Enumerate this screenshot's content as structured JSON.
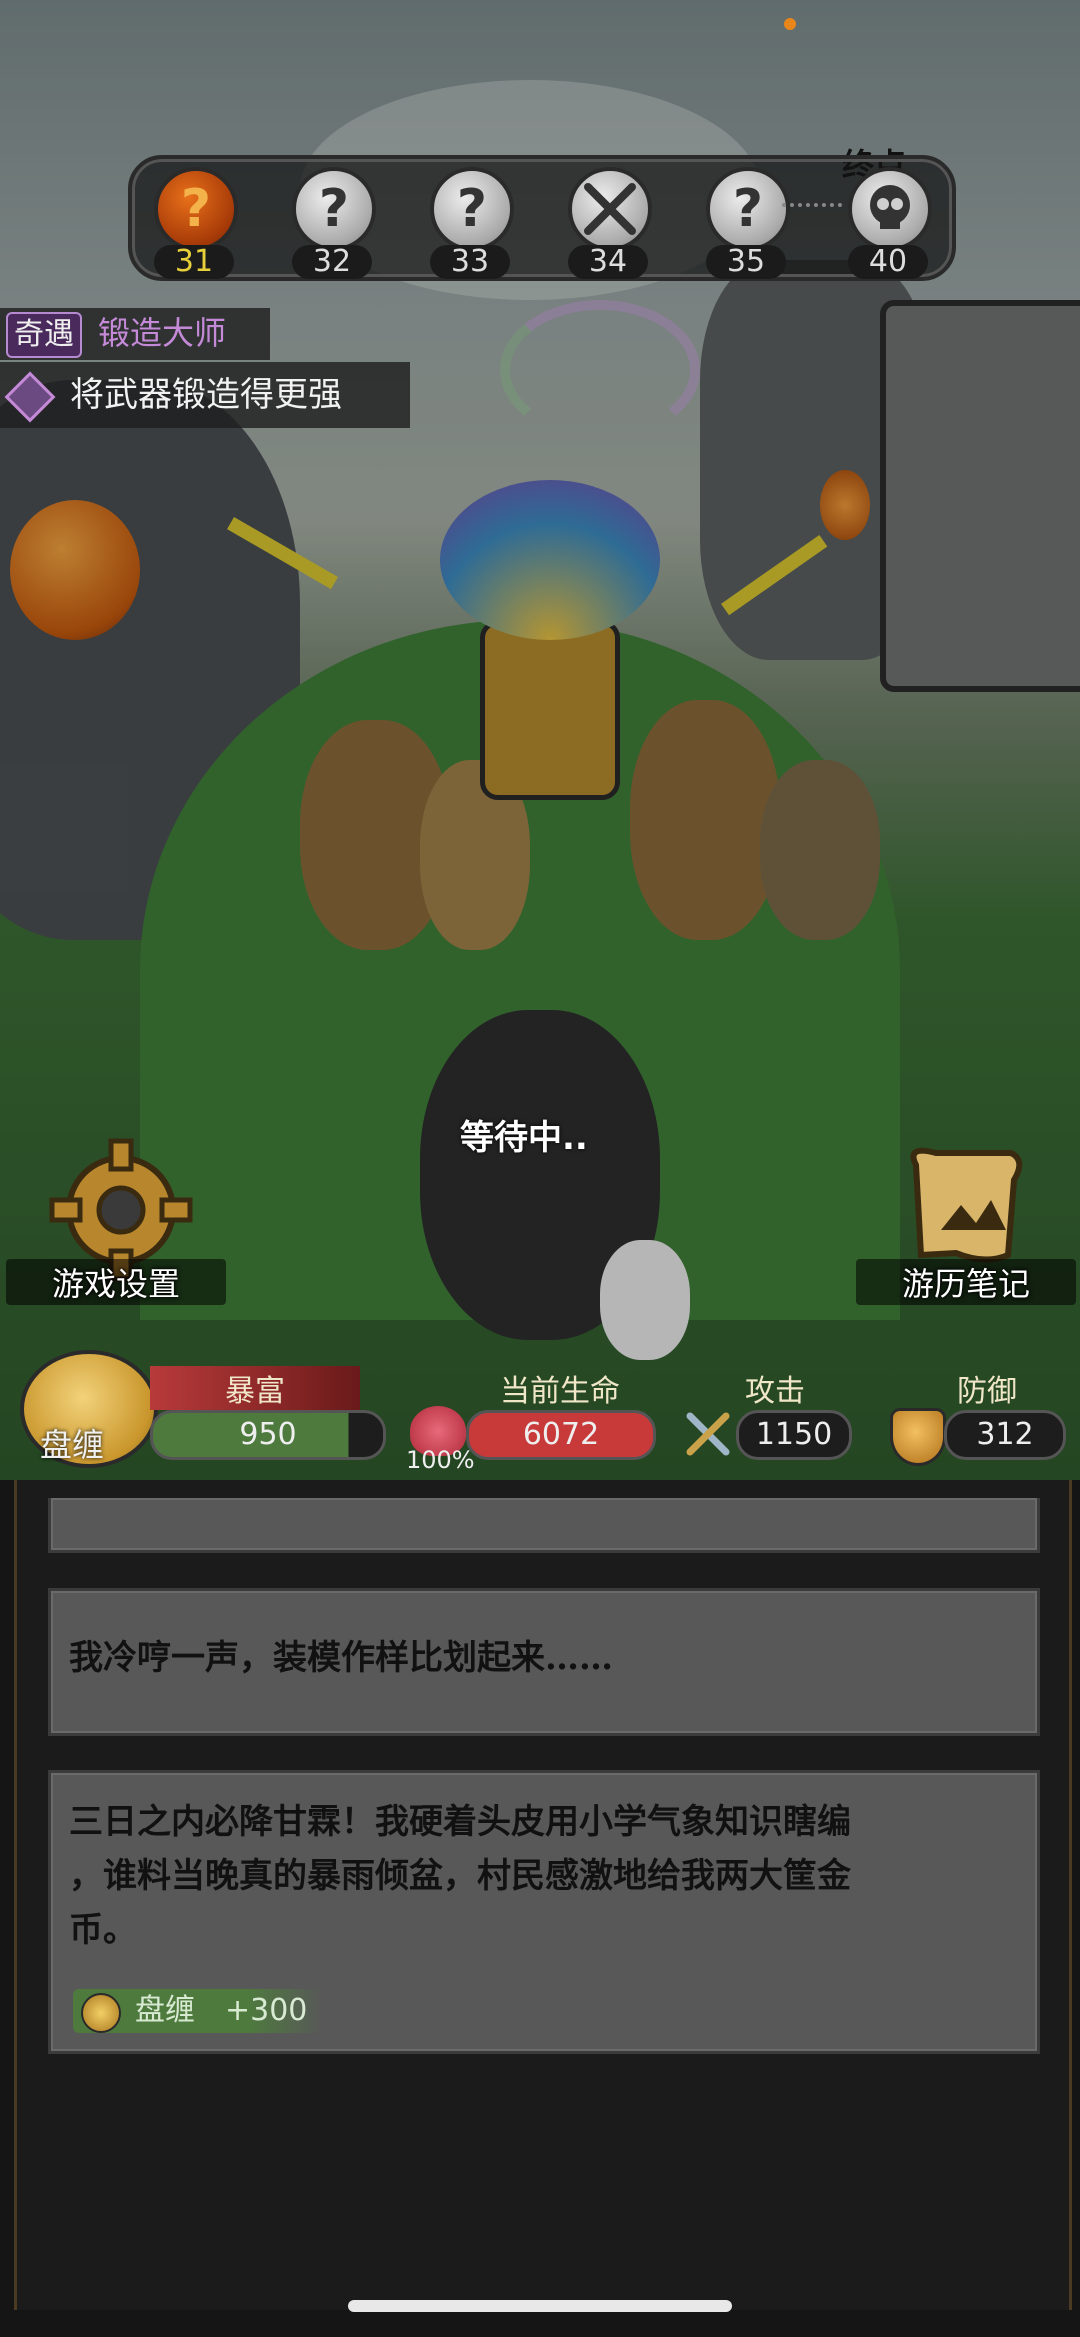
{
  "stages": [
    {
      "label": "?",
      "number": "31",
      "current": true
    },
    {
      "label": "?",
      "number": "32",
      "current": false
    },
    {
      "label": "?",
      "number": "33",
      "current": false
    },
    {
      "label": "sword",
      "number": "34",
      "current": false
    },
    {
      "label": "?",
      "number": "35",
      "current": false
    },
    {
      "label": "skull",
      "number": "40",
      "current": false
    }
  ],
  "end_label": "终点",
  "event": {
    "tag": "奇遇",
    "title": "锻造大师",
    "goal": "将武器锻造得更强"
  },
  "hud": {
    "settings_label": "游戏设置",
    "journal_label": "游历笔记",
    "waiting_text": "等待中.."
  },
  "stats": {
    "buff_title": "暴富",
    "coin_name": "盘缠",
    "coins": "950",
    "hp_title": "当前生命",
    "hp_percent": "100%",
    "hp": "6072",
    "atk_title": "攻击",
    "atk": "1150",
    "def_title": "防御",
    "def": "312"
  },
  "log": {
    "entry1": "我冷哼一声，装模作样比划起来……",
    "entry2_line1": "三日之内必降甘霖！我硬着头皮用小学气象知识瞎编",
    "entry2_line2": "，谁料当晚真的暴雨倾盆，村民感激地给我两大筐金",
    "entry2_line3": "币。",
    "reward_name": "盘缠",
    "reward_value": "+300"
  },
  "colors": {
    "accent_gold": "#e8c15a",
    "hp_red": "#c83a3a",
    "coin_green": "#4e7a3e",
    "event_purple": "#c48ad8"
  }
}
